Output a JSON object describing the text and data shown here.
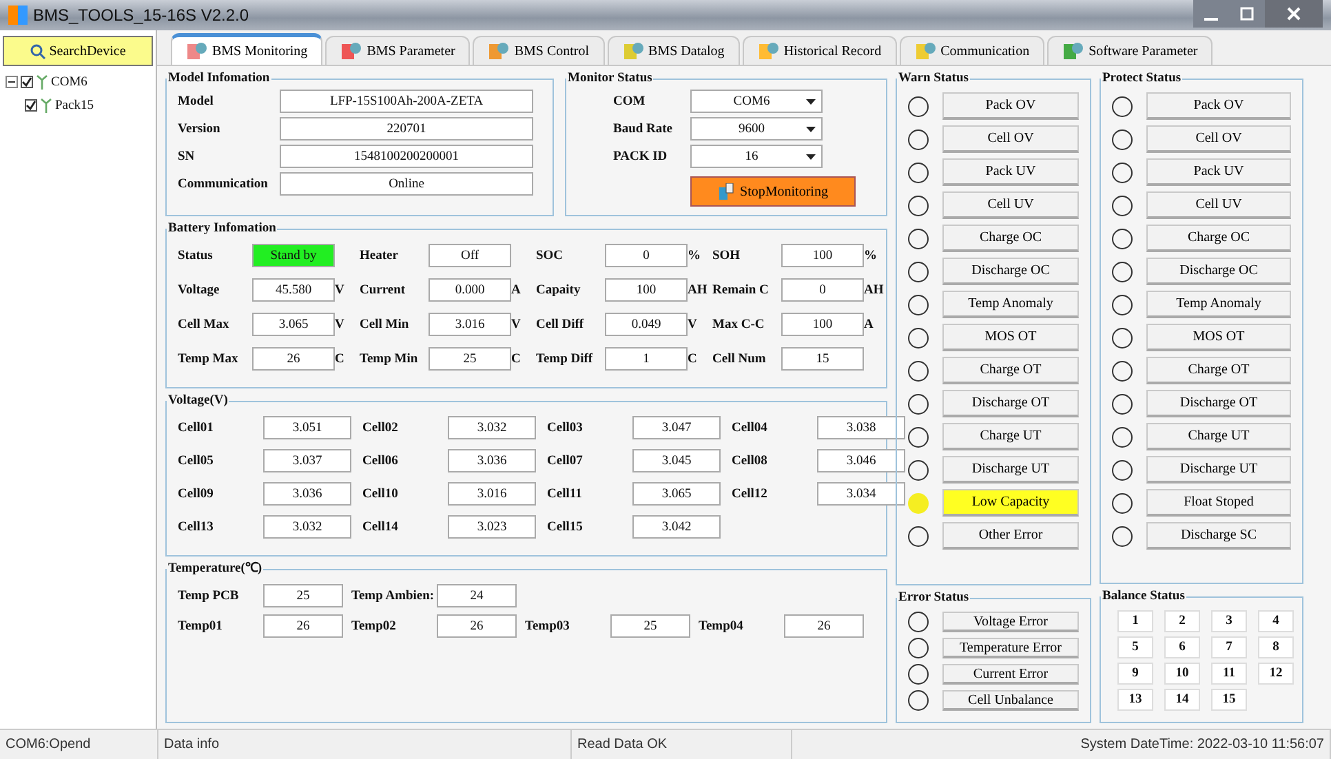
{
  "window": {
    "title": "BMS_TOOLS_15-16S V2.2.0"
  },
  "sidebar": {
    "search_button": "SearchDevice",
    "tree": [
      {
        "label": "COM6",
        "checked": true,
        "expanded": true,
        "children": [
          {
            "label": "Pack15",
            "checked": true
          }
        ]
      }
    ]
  },
  "tabs": [
    {
      "label": "BMS Monitoring",
      "selected": true
    },
    {
      "label": "BMS Parameter",
      "selected": false
    },
    {
      "label": "BMS Control",
      "selected": false
    },
    {
      "label": "BMS Datalog",
      "selected": false
    },
    {
      "label": "Historical Record",
      "selected": false
    },
    {
      "label": "Communication",
      "selected": false
    },
    {
      "label": "Software Parameter",
      "selected": false
    }
  ],
  "model_info": {
    "title": "Model Infomation",
    "fields": [
      {
        "label": "Model",
        "value": "LFP-15S100Ah-200A-ZETA"
      },
      {
        "label": "Version",
        "value": "220701"
      },
      {
        "label": "SN",
        "value": "1548100200200001"
      },
      {
        "label": "Communication",
        "value": "Online"
      }
    ]
  },
  "monitor_status": {
    "title": "Monitor Status",
    "selects": [
      {
        "label": "COM",
        "value": "COM6"
      },
      {
        "label": "Baud Rate",
        "value": "9600"
      },
      {
        "label": "PACK ID",
        "value": "16"
      }
    ],
    "button": "StopMonitoring"
  },
  "battery_info": {
    "title": "Battery Infomation",
    "rows": [
      [
        {
          "label": "Status",
          "value": "Stand by",
          "highlight": true
        },
        {
          "label": "Heater",
          "value": "Off",
          "highlight": false
        },
        {
          "label": "SOC",
          "value": "0",
          "unit": "%",
          "highlight": false
        },
        {
          "label": "SOH",
          "value": "100",
          "unit": "%",
          "highlight": false
        }
      ],
      [
        {
          "label": "Voltage",
          "value": "45.580",
          "unit": "V",
          "highlight": false
        },
        {
          "label": "Current",
          "value": "0.000",
          "unit": "A",
          "highlight": false
        },
        {
          "label": "Capaity",
          "value": "100",
          "unit": "AH",
          "highlight": false
        },
        {
          "label": "Remain C",
          "value": "0",
          "unit": "AH",
          "highlight": false
        }
      ],
      [
        {
          "label": "Cell Max",
          "value": "3.065",
          "unit": "V",
          "highlight": false
        },
        {
          "label": "Cell Min",
          "value": "3.016",
          "unit": "V",
          "highlight": false
        },
        {
          "label": "Cell Diff",
          "value": "0.049",
          "unit": "V",
          "highlight": false
        },
        {
          "label": "Max C-C",
          "value": "100",
          "unit": "A",
          "highlight": false
        }
      ],
      [
        {
          "label": "Temp Max",
          "value": "26",
          "unit": "C",
          "highlight": false
        },
        {
          "label": "Temp Min",
          "value": "25",
          "unit": "C",
          "highlight": false
        },
        {
          "label": "Temp Diff",
          "value": "1",
          "unit": "C",
          "highlight": false
        },
        {
          "label": "Cell Num",
          "value": "15",
          "highlight": false
        }
      ]
    ]
  },
  "voltage": {
    "title": "Voltage(V)",
    "cells": [
      {
        "label": "Cell01",
        "value": "3.051"
      },
      {
        "label": "Cell02",
        "value": "3.032"
      },
      {
        "label": "Cell03",
        "value": "3.047"
      },
      {
        "label": "Cell04",
        "value": "3.038"
      },
      {
        "label": "Cell05",
        "value": "3.037"
      },
      {
        "label": "Cell06",
        "value": "3.036"
      },
      {
        "label": "Cell07",
        "value": "3.045"
      },
      {
        "label": "Cell08",
        "value": "3.046"
      },
      {
        "label": "Cell09",
        "value": "3.036"
      },
      {
        "label": "Cell10",
        "value": "3.016"
      },
      {
        "label": "Cell11",
        "value": "3.065"
      },
      {
        "label": "Cell12",
        "value": "3.034"
      },
      {
        "label": "Cell13",
        "value": "3.032"
      },
      {
        "label": "Cell14",
        "value": "3.023"
      },
      {
        "label": "Cell15",
        "value": "3.042"
      }
    ]
  },
  "temperature": {
    "title": "Temperature(℃)",
    "rows": [
      [
        {
          "label": "Temp PCB",
          "value": "25"
        },
        {
          "label": "Temp Ambien:",
          "value": "24"
        }
      ],
      [
        {
          "label": "Temp01",
          "value": "26"
        },
        {
          "label": "Temp02",
          "value": "26"
        },
        {
          "label": "Temp03",
          "value": "25"
        },
        {
          "label": "Temp04",
          "value": "26"
        }
      ]
    ]
  },
  "warn_status": {
    "title": "Warn Status",
    "items": [
      {
        "label": "Pack OV",
        "on": false
      },
      {
        "label": "Cell OV",
        "on": false
      },
      {
        "label": "Pack UV",
        "on": false
      },
      {
        "label": "Cell UV",
        "on": false
      },
      {
        "label": "Charge OC",
        "on": false
      },
      {
        "label": "Discharge OC",
        "on": false
      },
      {
        "label": "Temp Anomaly",
        "on": false
      },
      {
        "label": "MOS OT",
        "on": false
      },
      {
        "label": "Charge OT",
        "on": false
      },
      {
        "label": "Discharge OT",
        "on": false
      },
      {
        "label": "Charge UT",
        "on": false
      },
      {
        "label": "Discharge UT",
        "on": false
      },
      {
        "label": "Low Capacity",
        "on": true
      },
      {
        "label": "Other Error",
        "on": false
      }
    ]
  },
  "protect_status": {
    "title": "Protect Status",
    "items": [
      {
        "label": "Pack OV",
        "on": false
      },
      {
        "label": "Cell OV",
        "on": false
      },
      {
        "label": "Pack UV",
        "on": false
      },
      {
        "label": "Cell UV",
        "on": false
      },
      {
        "label": "Charge OC",
        "on": false
      },
      {
        "label": "Discharge OC",
        "on": false
      },
      {
        "label": "Temp Anomaly",
        "on": false
      },
      {
        "label": "MOS OT",
        "on": false
      },
      {
        "label": "Charge OT",
        "on": false
      },
      {
        "label": "Discharge OT",
        "on": false
      },
      {
        "label": "Charge UT",
        "on": false
      },
      {
        "label": "Discharge UT",
        "on": false
      },
      {
        "label": "Float Stoped",
        "on": false
      },
      {
        "label": "Discharge SC",
        "on": false
      }
    ]
  },
  "error_status": {
    "title": "Error Status",
    "items": [
      {
        "label": "Voltage Error",
        "on": false
      },
      {
        "label": "Temperature Error",
        "on": false
      },
      {
        "label": "Current Error",
        "on": false
      },
      {
        "label": "Cell Unbalance",
        "on": false
      }
    ]
  },
  "balance_status": {
    "title": "Balance Status",
    "cells": [
      {
        "label": "1",
        "on": false
      },
      {
        "label": "2",
        "on": false
      },
      {
        "label": "3",
        "on": false
      },
      {
        "label": "4",
        "on": false
      },
      {
        "label": "5",
        "on": false
      },
      {
        "label": "6",
        "on": false
      },
      {
        "label": "7",
        "on": false
      },
      {
        "label": "8",
        "on": false
      },
      {
        "label": "9",
        "on": false
      },
      {
        "label": "10",
        "on": false
      },
      {
        "label": "11",
        "on": false
      },
      {
        "label": "12",
        "on": false
      },
      {
        "label": "13",
        "on": false
      },
      {
        "label": "14",
        "on": false
      },
      {
        "label": "15",
        "on": false
      }
    ]
  },
  "status_bar": [
    "COM6:Opend",
    "Data info",
    "Read Data OK",
    "System DateTime: 2022-03-10 11:56:07"
  ]
}
